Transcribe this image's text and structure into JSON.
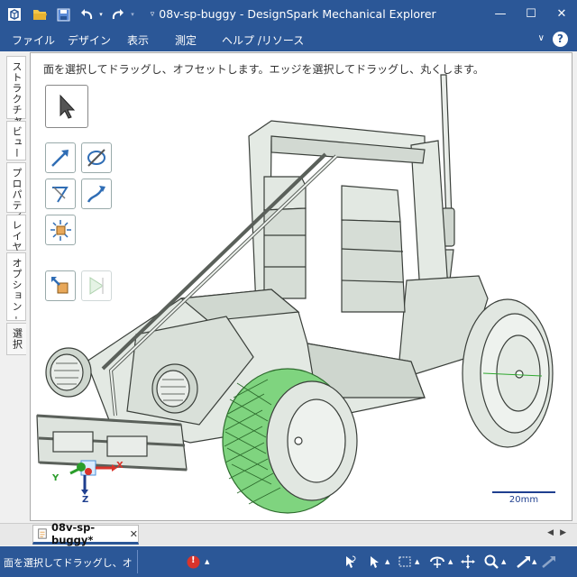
{
  "window": {
    "title": "08v-sp-buggy - DesignSpark Mechanical Explorer",
    "minimize_glyph": "—",
    "maximize_glyph": "☐",
    "close_glyph": "✕"
  },
  "quick_access": {
    "icons": [
      "app-logo-icon",
      "open-folder-icon",
      "save-icon",
      "undo-icon",
      "redo-icon",
      "customize-icon"
    ]
  },
  "menu": {
    "items": [
      "ファイル",
      "デザイン",
      "表示",
      "測定",
      "ヘルプ /リソース"
    ],
    "help_glyph": "?",
    "collapse_glyph": "∨"
  },
  "side_tabs": [
    "ストラクチャー",
    "ビュー",
    "プロパティ",
    "レイヤ",
    "オプション - プル",
    "選択"
  ],
  "viewport": {
    "hint": "面を選択してドラッグし、オフセットします。エッジを選択してドラッグし、丸くします。",
    "scale_label": "20mm",
    "axis_labels": {
      "x": "X",
      "y": "Y",
      "z": "Z"
    }
  },
  "tools": [
    "select-arrow-tool",
    "pull-direction-tool",
    "revolve-tool",
    "sweep-tool",
    "blend-tool",
    "scale-tool",
    "pull-options-tool",
    "no-merge-tool"
  ],
  "doc_tabs": {
    "active": "08v-sp-buggy*",
    "close_glyph": "✕",
    "nav_prev": "◀",
    "nav_next": "▶"
  },
  "status": {
    "text": "面を選択してドラッグし、オフセットします。",
    "error_glyph": "!"
  },
  "colors": {
    "titlebar": "#2b5797",
    "model_body": "#dfe6df",
    "tire_selected": "#7fd47f",
    "viewport_bg": "#ffffff"
  }
}
